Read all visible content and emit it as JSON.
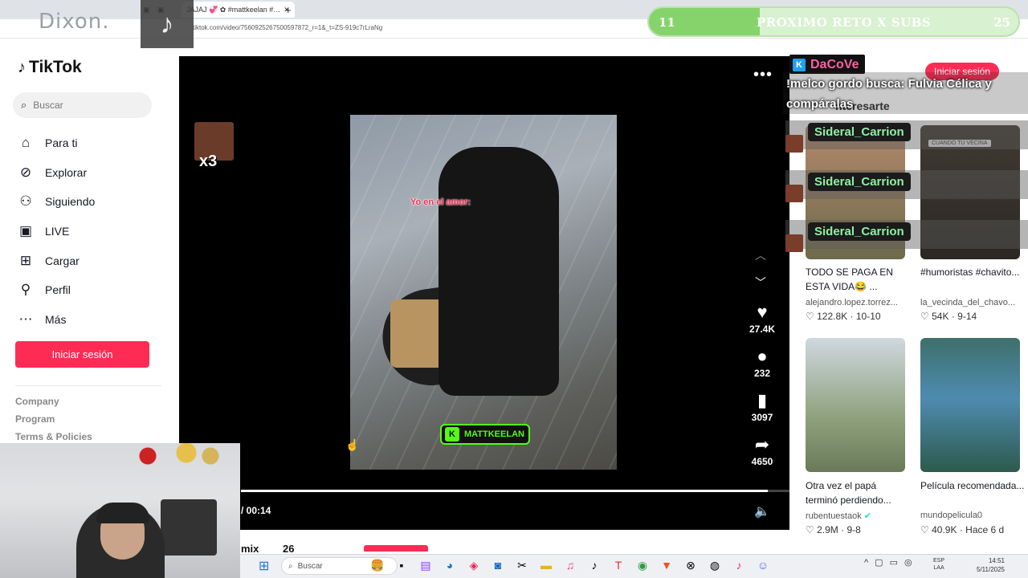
{
  "browser": {
    "tab_title": "JAJAJ 💞 ✿ #mattkeelan #…",
    "address": "tiktok.com/video/7560925267500597872_r=1&_t=ZS-919c7rLraNg"
  },
  "overlay": {
    "streamer_name": "Dixon.",
    "goal": {
      "left": "11",
      "text": "PROXIMO RETO X SUBS",
      "right": "25",
      "progress": 0.3
    }
  },
  "sidebar": {
    "logo": "TikTok",
    "search_placeholder": "Buscar",
    "items": [
      {
        "label": "Para ti",
        "icon": "home-icon"
      },
      {
        "label": "Explorar",
        "icon": "compass-icon"
      },
      {
        "label": "Siguiendo",
        "icon": "following-icon"
      },
      {
        "label": "LIVE",
        "icon": "live-icon"
      },
      {
        "label": "Cargar",
        "icon": "upload-icon"
      },
      {
        "label": "Perfil",
        "icon": "profile-icon"
      },
      {
        "label": "Más",
        "icon": "more-icon"
      }
    ],
    "login_label": "Iniciar sesión",
    "footer": [
      "Company",
      "Program",
      "Terms & Policies"
    ]
  },
  "video": {
    "caption": "Yo en el amor:",
    "watermark": "MATTKEELAN",
    "meme_label": "x3",
    "likes": "27.4K",
    "comments": "232",
    "saves": "3097",
    "shares": "4650",
    "time": "/ 00:14",
    "progress": 0.96
  },
  "right": {
    "login_pill": "Iniciar sesión",
    "chat_donor": "DaCoVe",
    "chat_message": "!melco gordo busca: Fulvia Célica y compáralas",
    "under_heading": "nteresarte",
    "chat_users": [
      "Sideral_Carrion",
      "Sideral_Carrion",
      "Sideral_Carrion"
    ],
    "thumb_tag": "CUANDO TU VECINA",
    "cards": [
      {
        "title": "TODO SE PAGA EN ESTA VIDA😂 ...",
        "author": "alejandro.lopez.torrez...",
        "likes": "122.8K",
        "date": "10-10"
      },
      {
        "title": "#humoristas #chavito...",
        "author": "la_vecinda_del_chavo...",
        "likes": "54K",
        "date": "9-14"
      },
      {
        "title": "Otra vez el papá terminó perdiendo...",
        "author": "rubentuestaok",
        "likes": "2.9M",
        "date": "9-8"
      },
      {
        "title": "Película recomendada...",
        "author": "mundopelicula0",
        "likes": "40.9K",
        "date": "Hace 6 d"
      }
    ]
  },
  "bottom": {
    "mix": "mix",
    "number": "26"
  },
  "taskbar": {
    "search": "Buscar",
    "lang_top": "ESP",
    "lang_bottom": "LAA",
    "time": "14:51",
    "date": "5/11/2025"
  }
}
